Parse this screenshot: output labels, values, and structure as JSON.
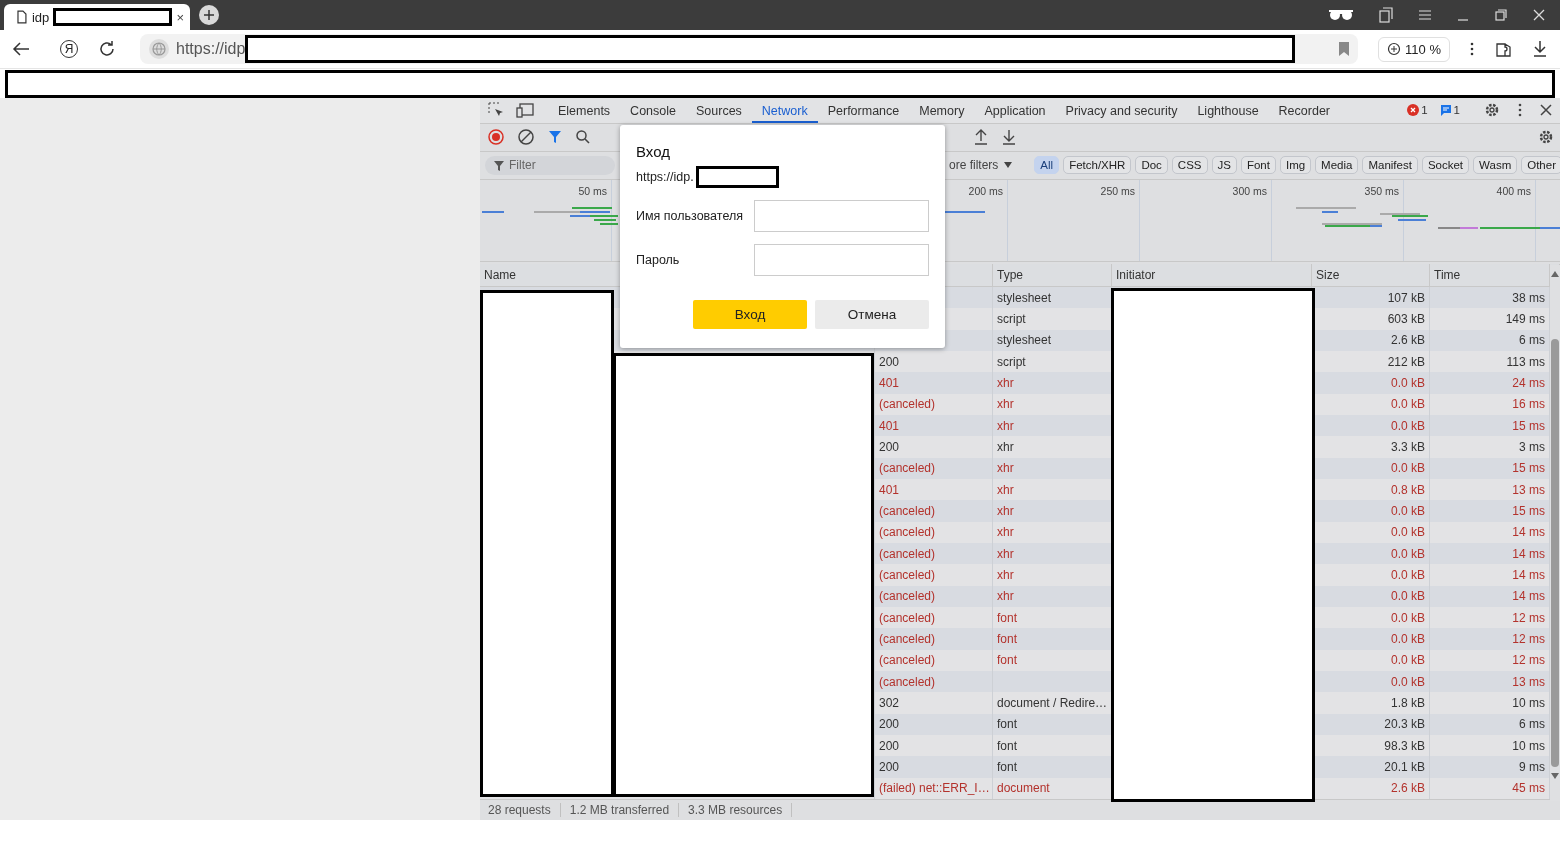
{
  "browser_tab": {
    "title": "idp",
    "close": "×"
  },
  "address_bar": {
    "home_button": "Я",
    "url": "https://idp",
    "zoom": "110 %"
  },
  "devtools": {
    "tabs": [
      {
        "label": "Elements",
        "selected": false
      },
      {
        "label": "Console",
        "selected": false
      },
      {
        "label": "Sources",
        "selected": false
      },
      {
        "label": "Network",
        "selected": true
      },
      {
        "label": "Performance",
        "selected": false
      },
      {
        "label": "Memory",
        "selected": false
      },
      {
        "label": "Application",
        "selected": false
      },
      {
        "label": "Privacy and security",
        "selected": false
      },
      {
        "label": "Lighthouse",
        "selected": false
      },
      {
        "label": "Recorder",
        "selected": false
      }
    ],
    "error_count": "1",
    "message_count": "1",
    "filter": {
      "placeholder": "Filter"
    },
    "more_filters": "ore filters",
    "type_filters": [
      {
        "label": "All",
        "selected": true
      },
      {
        "label": "Fetch/XHR",
        "selected": false
      },
      {
        "label": "Doc",
        "selected": false
      },
      {
        "label": "CSS",
        "selected": false
      },
      {
        "label": "JS",
        "selected": false
      },
      {
        "label": "Font",
        "selected": false
      },
      {
        "label": "Img",
        "selected": false
      },
      {
        "label": "Media",
        "selected": false
      },
      {
        "label": "Manifest",
        "selected": false
      },
      {
        "label": "Socket",
        "selected": false
      },
      {
        "label": "Wasm",
        "selected": false
      },
      {
        "label": "Other",
        "selected": false
      }
    ],
    "timeline_ticks": [
      "50 ms",
      "200 ms",
      "250 ms",
      "300 ms",
      "350 ms",
      "400 ms"
    ],
    "columns": [
      "Name",
      "Type",
      "Initiator",
      "Size",
      "Time"
    ],
    "rows": [
      {
        "type": "stylesheet",
        "size": "107 kB",
        "time": "38 ms",
        "failed": false
      },
      {
        "type": "script",
        "size": "603 kB",
        "time": "149 ms",
        "failed": false
      },
      {
        "type": "stylesheet",
        "size": "2.6 kB",
        "time": "6 ms",
        "failed": false
      },
      {
        "status": "200",
        "type": "script",
        "size": "212 kB",
        "time": "113 ms",
        "failed": false
      },
      {
        "status": "401",
        "type": "xhr",
        "size": "0.0 kB",
        "time": "24 ms",
        "failed": true
      },
      {
        "status": "(canceled)",
        "type": "xhr",
        "size": "0.0 kB",
        "time": "16 ms",
        "failed": true
      },
      {
        "status": "401",
        "type": "xhr",
        "size": "0.0 kB",
        "time": "15 ms",
        "failed": true
      },
      {
        "status": "200",
        "type": "xhr",
        "size": "3.3 kB",
        "time": "3 ms",
        "failed": false
      },
      {
        "status": "(canceled)",
        "type": "xhr",
        "size": "0.0 kB",
        "time": "15 ms",
        "failed": true
      },
      {
        "status": "401",
        "type": "xhr",
        "size": "0.8 kB",
        "time": "13 ms",
        "failed": true
      },
      {
        "status": "(canceled)",
        "type": "xhr",
        "size": "0.0 kB",
        "time": "15 ms",
        "failed": true
      },
      {
        "status": "(canceled)",
        "type": "xhr",
        "size": "0.0 kB",
        "time": "14 ms",
        "failed": true
      },
      {
        "status": "(canceled)",
        "type": "xhr",
        "size": "0.0 kB",
        "time": "14 ms",
        "failed": true
      },
      {
        "status": "(canceled)",
        "type": "xhr",
        "size": "0.0 kB",
        "time": "14 ms",
        "failed": true
      },
      {
        "status": "(canceled)",
        "type": "xhr",
        "size": "0.0 kB",
        "time": "14 ms",
        "failed": true
      },
      {
        "status": "(canceled)",
        "type": "font",
        "size": "0.0 kB",
        "time": "12 ms",
        "failed": true
      },
      {
        "status": "(canceled)",
        "type": "font",
        "size": "0.0 kB",
        "time": "12 ms",
        "failed": true
      },
      {
        "status": "(canceled)",
        "type": "font",
        "size": "0.0 kB",
        "time": "12 ms",
        "failed": true
      },
      {
        "status": "(canceled)",
        "size": "0.0 kB",
        "time": "13 ms",
        "failed": true
      },
      {
        "status": "302",
        "type": "document / Redire…",
        "size": "1.8 kB",
        "time": "10 ms",
        "failed": false
      },
      {
        "status": "200",
        "type": "font",
        "size": "20.3 kB",
        "time": "6 ms",
        "failed": false
      },
      {
        "status": "200",
        "type": "font",
        "size": "98.3 kB",
        "time": "10 ms",
        "failed": false
      },
      {
        "status": "200",
        "type": "font",
        "size": "20.1 kB",
        "time": "9 ms",
        "failed": false
      },
      {
        "status": "(failed) net::ERR_I…",
        "type": "document",
        "size": "2.6 kB",
        "time": "45 ms",
        "failed": true
      }
    ],
    "summary": [
      "28 requests",
      "1.2 MB transferred",
      "3.3 MB resources"
    ]
  },
  "dialog": {
    "title": "Вход",
    "origin": "https://idp.",
    "fields": [
      {
        "label": "Имя пользователя"
      },
      {
        "label": "Пароль"
      }
    ],
    "buttons": [
      {
        "label": "Вход",
        "primary": true
      },
      {
        "label": "Отмена",
        "primary": false
      }
    ]
  }
}
